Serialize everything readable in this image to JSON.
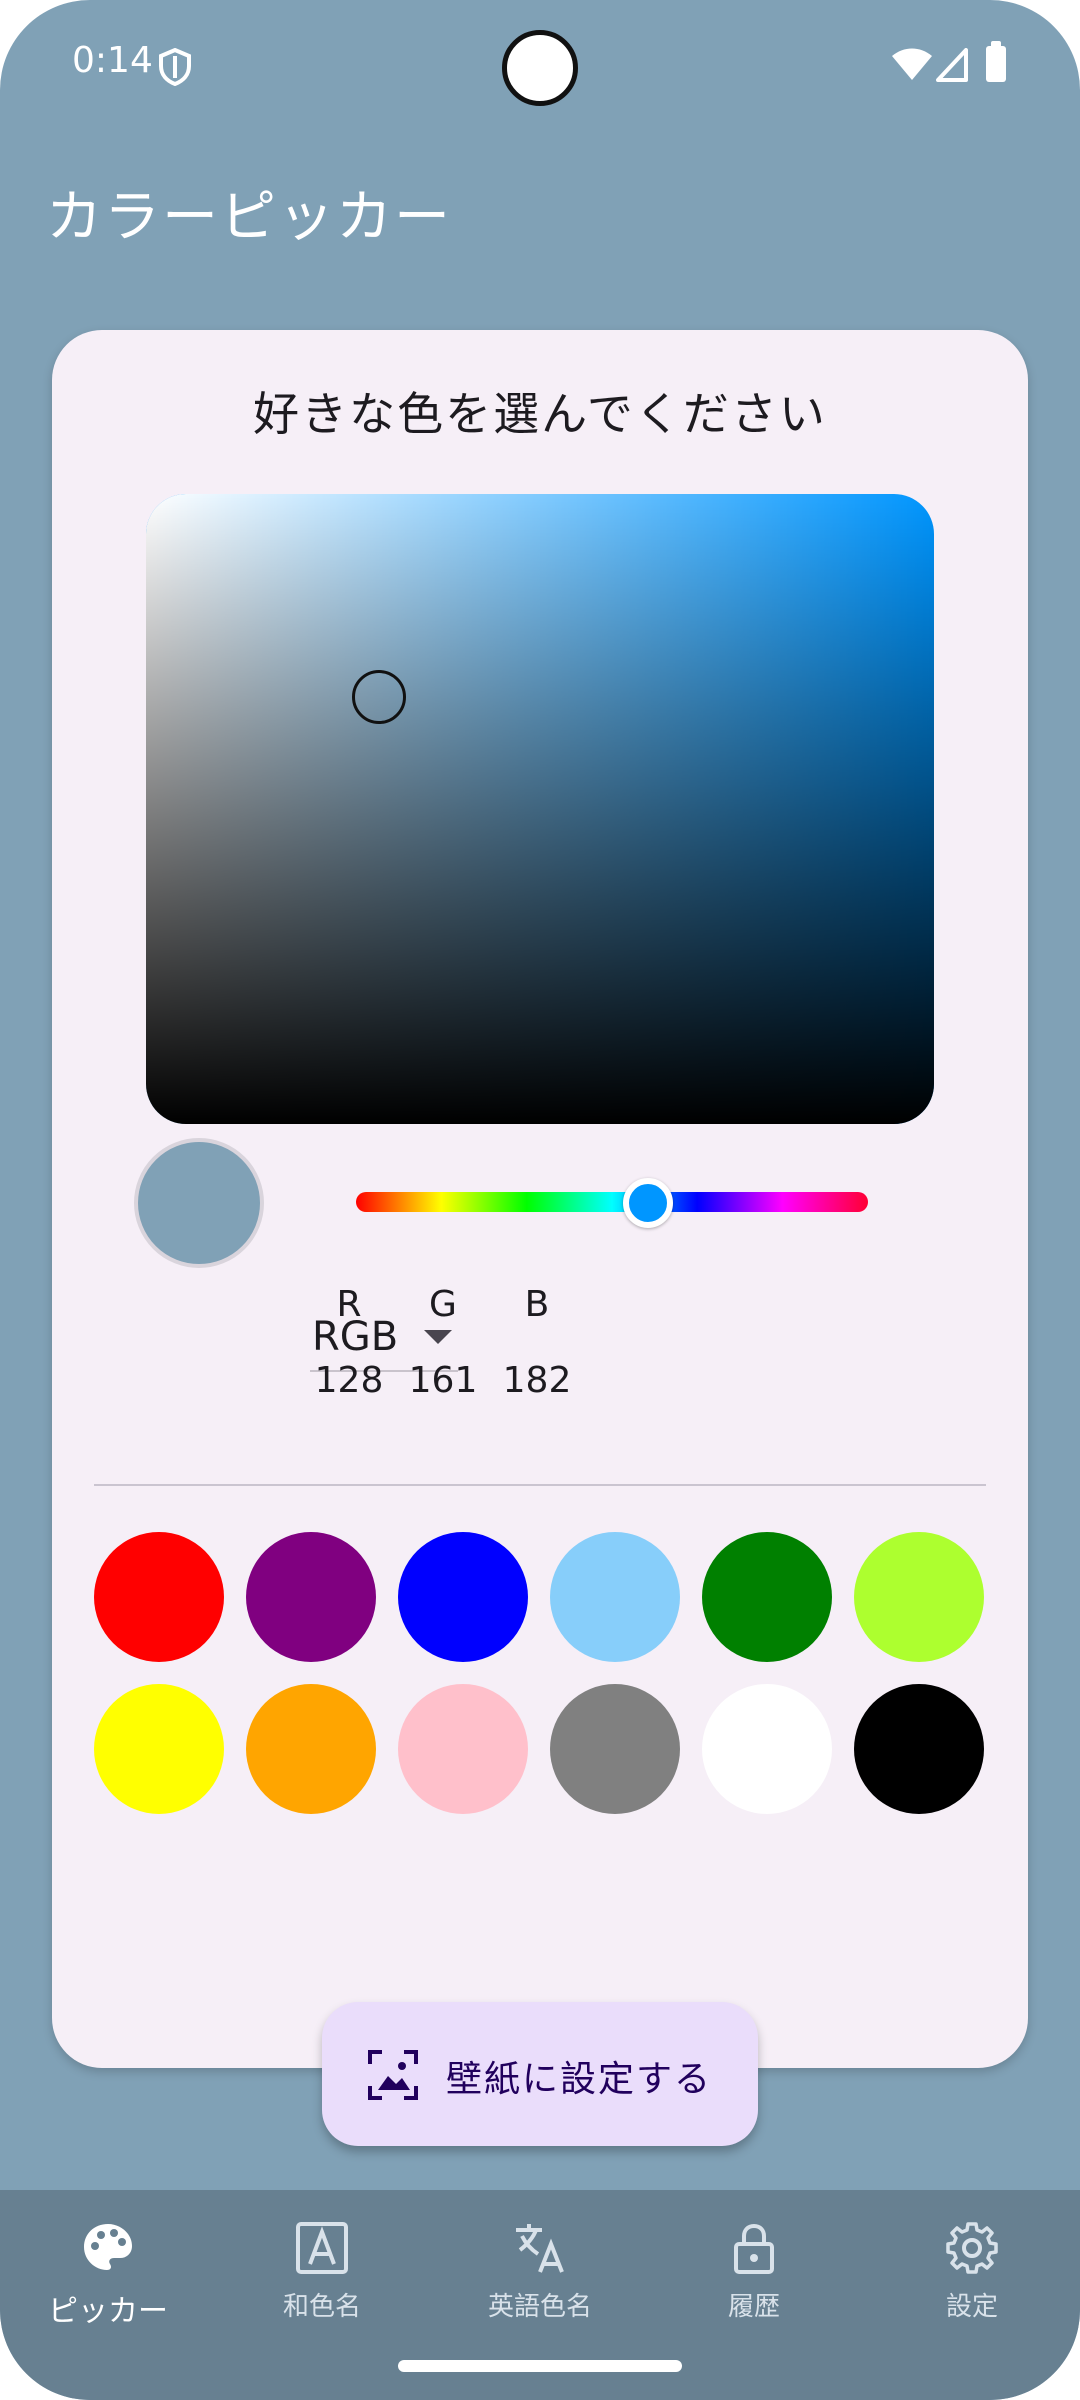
{
  "status_bar": {
    "time": "0:14"
  },
  "app_bar": {
    "title": "カラーピッカー"
  },
  "picker": {
    "prompt": "好きな色を選んでください",
    "hue_color": "#0096ff",
    "hue_fraction": 0.57,
    "selected_color": "#80a1b6",
    "mode": "RGB",
    "channels": [
      {
        "label": "R",
        "value": "128"
      },
      {
        "label": "G",
        "value": "161"
      },
      {
        "label": "B",
        "value": "182"
      }
    ]
  },
  "swatches": [
    "#ff0000",
    "#800080",
    "#0000ff",
    "#87cefa",
    "#008000",
    "#adff2f",
    "#ffff00",
    "#ffa500",
    "#ffc0cb",
    "#808080",
    "#ffffff",
    "#000000"
  ],
  "wallpaper_button": {
    "label": "壁紙に設定する",
    "icon": "wallpaper-icon"
  },
  "bottom_nav": {
    "items": [
      {
        "label": "ピッカー",
        "icon": "palette-icon",
        "active": true
      },
      {
        "label": "和色名",
        "icon": "letter-a-icon",
        "active": false
      },
      {
        "label": "英語色名",
        "icon": "translate-icon",
        "active": false
      },
      {
        "label": "履歴",
        "icon": "lock-icon",
        "active": false
      },
      {
        "label": "設定",
        "icon": "gear-icon",
        "active": false
      }
    ]
  }
}
